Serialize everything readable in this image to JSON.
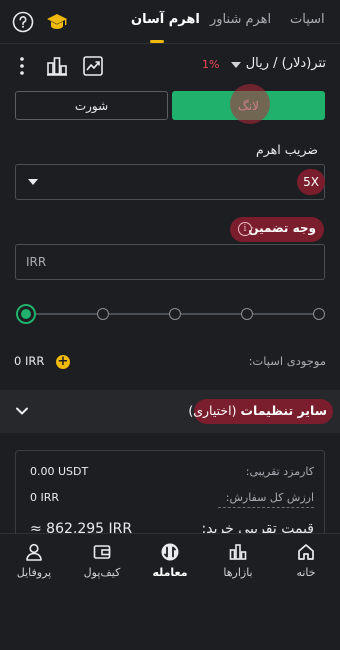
{
  "nav": {
    "tabs": [
      {
        "label": "اسپات"
      },
      {
        "label": "اهرم شناور"
      },
      {
        "label": "اهرم آسان"
      }
    ],
    "active_tab": "اهرم آسان"
  },
  "pair": {
    "name": "تتر(دلار) / ریال",
    "change": "1%"
  },
  "trade_side": {
    "long_label": "لانگ",
    "short_label": "شورت"
  },
  "leverage": {
    "label": "ضریب اهرم",
    "value": "5X"
  },
  "margin": {
    "label": "وجه تضمین",
    "placeholder": "IRR"
  },
  "slider": {
    "value_fraction": 0,
    "stops": 5
  },
  "available": {
    "label": "موجودی اسپات:",
    "value": "0 IRR"
  },
  "other_settings": {
    "label": "سایر تنظیمات",
    "optional": "(اختیاری)"
  },
  "summary": {
    "rows": [
      {
        "label": "کارمزد تقریبی:",
        "value": "0.00 USDT"
      },
      {
        "label": "ارزش کل سفارش:",
        "value": "0 IRR"
      },
      {
        "label": "قیمت تقریبی خرید:",
        "value": "≈ 862,295 IRR"
      }
    ]
  },
  "bottom_nav": {
    "items": [
      {
        "label": "خانه",
        "icon": "home-icon"
      },
      {
        "label": "بازارها",
        "icon": "markets-icon"
      },
      {
        "label": "معامله",
        "icon": "trade-icon"
      },
      {
        "label": "کیف‌پول",
        "icon": "wallet-icon"
      },
      {
        "label": "پروفایل",
        "icon": "profile-icon"
      }
    ],
    "active": "معامله"
  },
  "colors": {
    "accent": "#f0b90b",
    "long": "#20b26c",
    "highlight": "#7a1d2c",
    "background": "#1c1e21"
  }
}
